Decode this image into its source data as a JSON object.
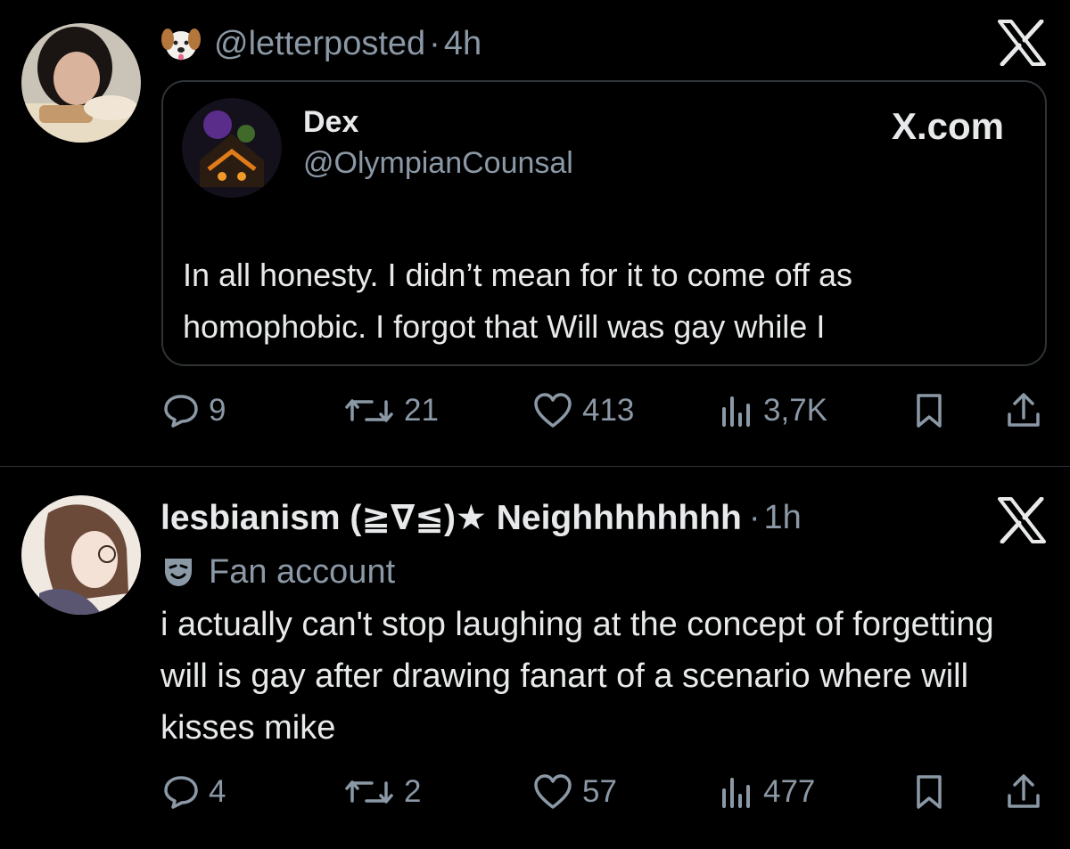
{
  "posts": [
    {
      "handle": "@letterposted",
      "time": "4h",
      "brand_logo": "X",
      "quote": {
        "name": "Dex",
        "handle": "@OlympianCounsal",
        "brand": "X.com",
        "text": "In all honesty. I didn’t mean for it to come off as homophobic. I forgot that Will was gay while I"
      },
      "actions": {
        "replies": "9",
        "reposts": "21",
        "likes": "413",
        "views": "3,7K"
      }
    },
    {
      "name": "lesbianism (≧∇≦)★ Neighhhhhhhh",
      "time": "1h",
      "brand_logo": "X",
      "fan_label": "Fan account",
      "text": "i actually can't stop laughing at the concept of forgetting will is gay after drawing fanart of a scenario where will kisses mike",
      "actions": {
        "replies": "4",
        "reposts": "2",
        "likes": "57",
        "views": "477"
      }
    }
  ],
  "icons": {
    "puppy": "dog-face-emoji",
    "fan": "theater-mask-icon",
    "reply": "speech-bubble-icon",
    "repost": "repost-arrows-icon",
    "like": "heart-icon",
    "views": "bar-chart-icon",
    "bookmark": "bookmark-icon",
    "share": "share-icon"
  },
  "colors": {
    "background": "#000000",
    "text": "#e7e9ea",
    "muted": "#8b98a5",
    "border": "#2f3336"
  }
}
